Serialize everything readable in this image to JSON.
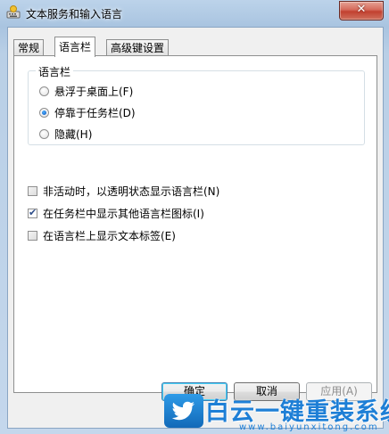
{
  "window": {
    "title": "文本服务和输入语言",
    "close_glyph": "✕"
  },
  "tabs": [
    {
      "label": "常规",
      "active": false
    },
    {
      "label": "语言栏",
      "active": true
    },
    {
      "label": "高级键设置",
      "active": false
    }
  ],
  "language_bar_group": {
    "title": "语言栏",
    "options": [
      {
        "label": "悬浮于桌面上(F)",
        "checked": false
      },
      {
        "label": "停靠于任务栏(D)",
        "checked": true
      },
      {
        "label": "隐藏(H)",
        "checked": false
      }
    ]
  },
  "checkboxes": [
    {
      "label": "非活动时，以透明状态显示语言栏(N)",
      "checked": false
    },
    {
      "label": "在任务栏中显示其他语言栏图标(I)",
      "checked": true
    },
    {
      "label": "在语言栏上显示文本标签(E)",
      "checked": false
    }
  ],
  "buttons": {
    "ok": "确定",
    "cancel": "取消",
    "apply": "应用(A)"
  },
  "watermark": {
    "text": "白云一键重装系统",
    "url": "www.baiyunxitong.com",
    "icon": "twitter-bird-icon"
  },
  "colors": {
    "accent": "#3c7fb1",
    "close": "#c1402f",
    "watermark": "#1e7fd6"
  }
}
